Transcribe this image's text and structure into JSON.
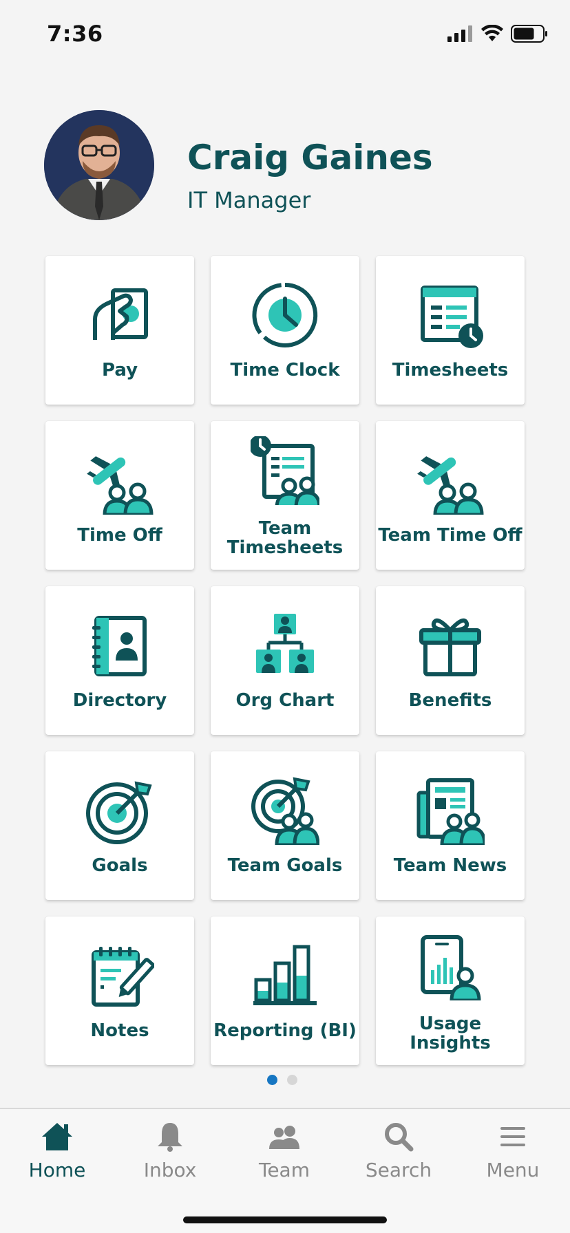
{
  "status": {
    "time": "7:36"
  },
  "profile": {
    "name": "Craig Gaines",
    "role": "IT Manager"
  },
  "colors": {
    "primary": "#0f5257",
    "accent": "#2ec4b6",
    "active_dot": "#1676c2"
  },
  "tiles": [
    {
      "label": "Pay",
      "icon": "pay-icon"
    },
    {
      "label": "Time Clock",
      "icon": "clock-icon"
    },
    {
      "label": "Timesheets",
      "icon": "timesheets-icon"
    },
    {
      "label": "Time Off",
      "icon": "time-off-icon"
    },
    {
      "label_line1": "Team",
      "label_line2": "Timesheets",
      "icon": "team-timesheets-icon"
    },
    {
      "label": "Team Time Off",
      "icon": "team-time-off-icon"
    },
    {
      "label": "Directory",
      "icon": "directory-icon"
    },
    {
      "label": "Org Chart",
      "icon": "org-chart-icon"
    },
    {
      "label": "Benefits",
      "icon": "gift-icon"
    },
    {
      "label": "Goals",
      "icon": "target-icon"
    },
    {
      "label": "Team Goals",
      "icon": "team-goals-icon"
    },
    {
      "label": "Team News",
      "icon": "news-icon"
    },
    {
      "label": "Notes",
      "icon": "notes-icon"
    },
    {
      "label": "Reporting (BI)",
      "icon": "bar-chart-icon"
    },
    {
      "label_line1": "Usage",
      "label_line2": "Insights",
      "icon": "usage-insights-icon"
    }
  ],
  "pager": {
    "pages": 2,
    "current": 1
  },
  "tab_bar": {
    "home": "Home",
    "inbox": "Inbox",
    "team": "Team",
    "search": "Search",
    "menu": "Menu"
  }
}
